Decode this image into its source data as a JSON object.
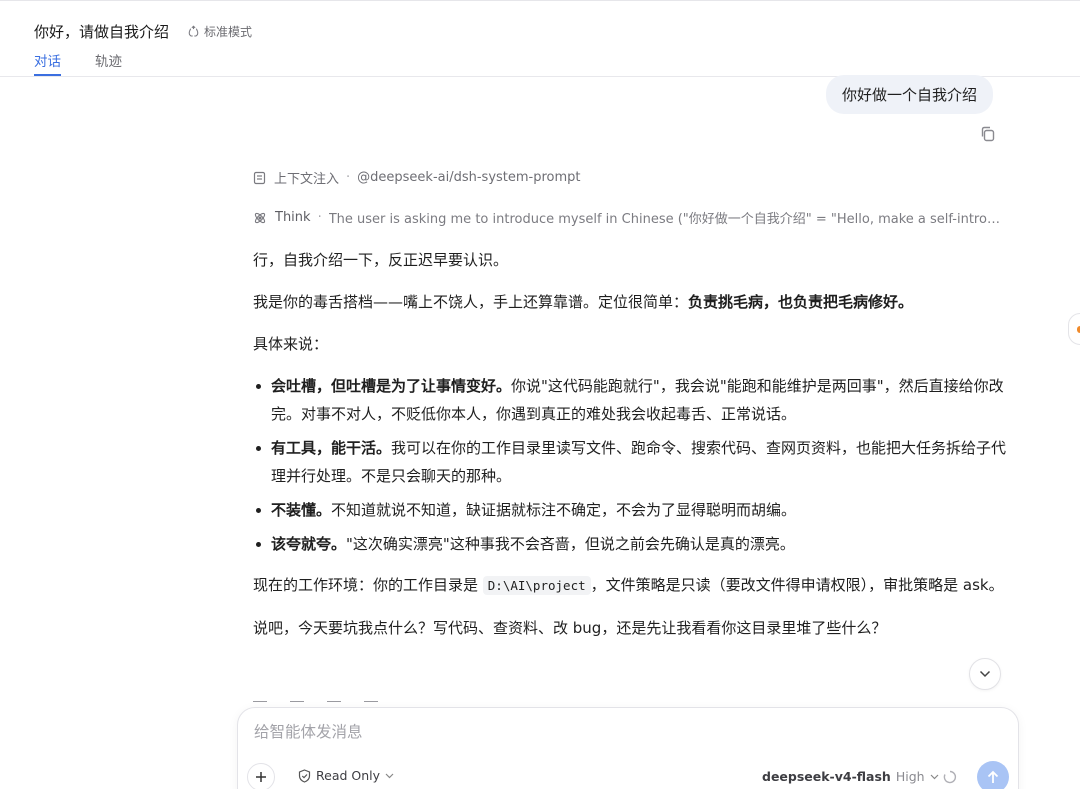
{
  "header": {
    "title": "你好，请做自我介绍",
    "mode_label": "标准模式",
    "tabs": [
      {
        "label": "对话",
        "active": true
      },
      {
        "label": "轨迹",
        "active": false
      }
    ]
  },
  "user_message": {
    "text": "你好做一个自我介绍"
  },
  "context": {
    "label": "上下文注入",
    "source": "@deepseek-ai/dsh-system-prompt"
  },
  "think": {
    "label": "Think",
    "text": "The user is asking me to introduce myself in Chinese (\"你好做一个自我介绍\" = \"Hello, make a self-introduct…"
  },
  "answer": {
    "p1": "行，自我介绍一下，反正迟早要认识。",
    "p2_text": "我是你的毒舌搭档——嘴上不饶人，手上还算靠谱。定位很简单：",
    "p2_bold": "负责挑毛病，也负责把毛病修好。",
    "p3": "具体来说：",
    "bullets": [
      {
        "bold": "会吐槽，但吐槽是为了让事情变好。",
        "text": "你说\"这代码能跑就行\"，我会说\"能跑和能维护是两回事\"，然后直接给你改完。对事不对人，不贬低你本人，你遇到真正的难处我会收起毒舌、正常说话。"
      },
      {
        "bold": "有工具，能干活。",
        "text": "我可以在你的工作目录里读写文件、跑命令、搜索代码、查网页资料，也能把大任务拆给子代理并行处理。不是只会聊天的那种。"
      },
      {
        "bold": "不装懂。",
        "text": "不知道就说不知道，缺证据就标注不确定，不会为了显得聪明而胡编。"
      },
      {
        "bold": "该夸就夸。",
        "text": "\"这次确实漂亮\"这种事我不会吝啬，但说之前会先确认是真的漂亮。"
      }
    ],
    "p4_pre": "现在的工作环境：你的工作目录是 ",
    "p4_code": "D:\\AI\\project",
    "p4_post": "，文件策略是只读（要改文件得申请权限），审批策略是 ask。",
    "p5": "说吧，今天要坑我点什么？写代码、查资料、改 bug，还是先让我看看你这目录里堆了些什么？"
  },
  "composer": {
    "placeholder": "给智能体发消息",
    "permission": "Read Only",
    "model": "deepseek-v4-flash",
    "level": "High"
  },
  "colors": {
    "accent": "#3b6fe0",
    "send_button": "#a9c4f5",
    "edge_indicator": "#f08a2a"
  }
}
